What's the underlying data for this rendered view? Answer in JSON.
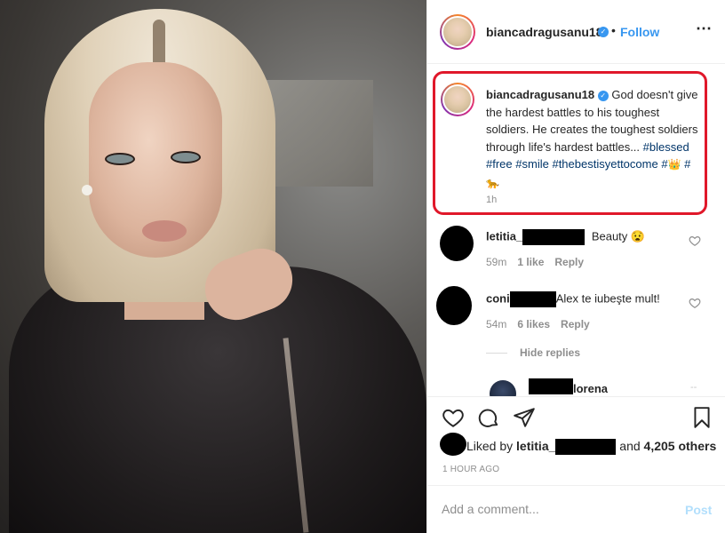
{
  "header": {
    "username": "biancadragusanu18",
    "dot": "•",
    "follow_label": "Follow",
    "more_icon": "⋯"
  },
  "caption": {
    "username": "biancadragusanu18",
    "text": "God doesn't give the hardest battles to his toughest soldiers. He creates the toughest soldiers through life's hardest battles...",
    "hashtags": [
      "#blessed",
      "#free",
      "#smile",
      "#thebestisyettocome",
      "#",
      "#"
    ],
    "emojis": [
      "crown-icon",
      "leopard-icon"
    ],
    "time": "1h"
  },
  "comments": [
    {
      "username": "letitia_",
      "text": "Beauty",
      "emoji": "frowning-face-icon",
      "time": "59m",
      "likes": "1 like",
      "reply_label": "Reply"
    },
    {
      "username": "coni",
      "text": "Alex te iubeşte mult!",
      "time": "54m",
      "likes": "6 likes",
      "reply_label": "Reply"
    }
  ],
  "hide_replies_label": "Hide replies",
  "reply_preview": {
    "username": "lorena"
  },
  "likes": {
    "prefix": "Liked by",
    "user": "letitia_",
    "and": "and",
    "others": "4,205 others"
  },
  "timestamp": "1 HOUR AGO",
  "add_comment": {
    "placeholder": "Add a comment...",
    "post_label": "Post"
  },
  "colors": {
    "accent": "#3897f0",
    "highlight_border": "#e0182a",
    "hashtag": "#003569",
    "muted": "#8e8e8e"
  }
}
